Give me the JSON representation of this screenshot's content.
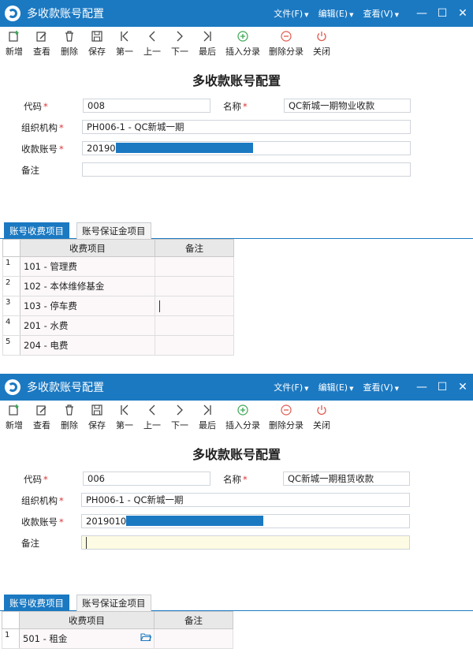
{
  "panels": [
    {
      "titlebar": {
        "title": "多收款账号配置",
        "menus": [
          "文件(F)",
          "编辑(E)",
          "查看(V)"
        ]
      },
      "toolbar": [
        {
          "icon": "new-icon",
          "label": "新增"
        },
        {
          "icon": "view-icon",
          "label": "查看"
        },
        {
          "icon": "trash-icon",
          "label": "删除"
        },
        {
          "icon": "save-icon",
          "label": "保存"
        },
        {
          "icon": "first-icon",
          "label": "第一"
        },
        {
          "icon": "prev-icon",
          "label": "上一"
        },
        {
          "icon": "next-icon",
          "label": "下一"
        },
        {
          "icon": "last-icon",
          "label": "最后"
        },
        {
          "icon": "plus-circle-icon",
          "label": "插入分录"
        },
        {
          "icon": "minus-circle-icon",
          "label": "删除分录"
        },
        {
          "icon": "power-icon",
          "label": "关闭"
        }
      ],
      "form": {
        "title": "多收款账号配置",
        "code_label": "代码",
        "code_value": "008",
        "name_label": "名称",
        "name_value": "QC新城一期物业收款",
        "org_label": "组织机构",
        "org_value": "PH006-1 - QC新城一期",
        "account_label": "收款账号",
        "account_value": "20190",
        "remark_label": "备注",
        "remark_value": ""
      },
      "tabs": [
        "账号收费项目",
        "账号保证金项目"
      ],
      "grid": {
        "headers": [
          "收费项目",
          "备注"
        ],
        "rows": [
          {
            "no": "1",
            "item": "101 - 管理费",
            "note": ""
          },
          {
            "no": "2",
            "item": "102 - 本体维修基金",
            "note": ""
          },
          {
            "no": "3",
            "item": "103 - 停车费",
            "note": ""
          },
          {
            "no": "4",
            "item": "201 - 水费",
            "note": ""
          },
          {
            "no": "5",
            "item": "204 - 电费",
            "note": ""
          }
        ]
      }
    },
    {
      "titlebar": {
        "title": "多收款账号配置",
        "menus": [
          "文件(F)",
          "编辑(E)",
          "查看(V)"
        ]
      },
      "toolbar": [
        {
          "icon": "new-icon",
          "label": "新增"
        },
        {
          "icon": "view-icon",
          "label": "查看"
        },
        {
          "icon": "trash-icon",
          "label": "删除"
        },
        {
          "icon": "save-icon",
          "label": "保存"
        },
        {
          "icon": "first-icon",
          "label": "第一"
        },
        {
          "icon": "prev-icon",
          "label": "上一"
        },
        {
          "icon": "next-icon",
          "label": "下一"
        },
        {
          "icon": "last-icon",
          "label": "最后"
        },
        {
          "icon": "plus-circle-icon",
          "label": "插入分录"
        },
        {
          "icon": "minus-circle-icon",
          "label": "删除分录"
        },
        {
          "icon": "power-icon",
          "label": "关闭"
        }
      ],
      "form": {
        "title": "多收款账号配置",
        "code_label": "代码",
        "code_value": "006",
        "name_label": "名称",
        "name_value": "QC新城一期租赁收款",
        "org_label": "组织机构",
        "org_value": "PH006-1 - QC新城一期",
        "account_label": "收款账号",
        "account_value": "2019010",
        "remark_label": "备注",
        "remark_value": ""
      },
      "tabs": [
        "账号收费项目",
        "账号保证金项目"
      ],
      "grid": {
        "headers": [
          "收费项目",
          "备注"
        ],
        "rows": [
          {
            "no": "1",
            "item": "501 - 租金",
            "note": ""
          }
        ]
      }
    }
  ],
  "colors": {
    "accent": "#1b79c2",
    "required": "#dd3333",
    "green_icon": "#3aa655",
    "red_icon": "#e05a4f"
  }
}
